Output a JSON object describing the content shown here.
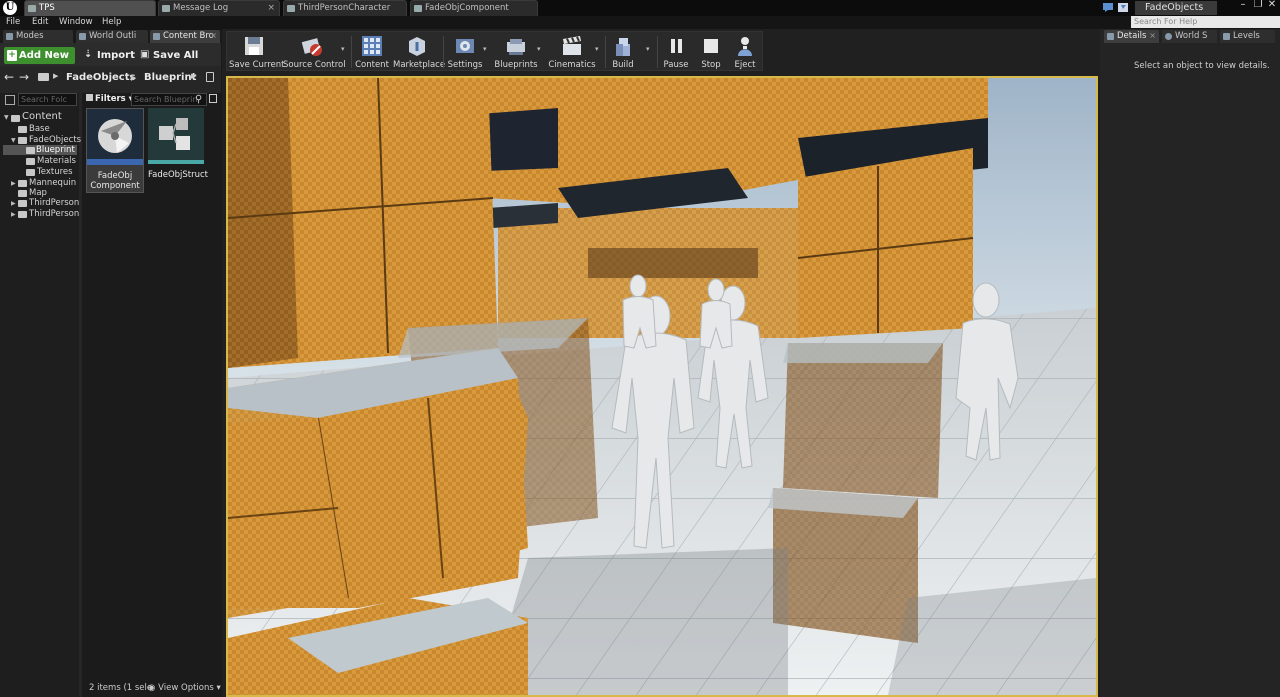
{
  "titlebar": {
    "tabs": [
      {
        "label": "TPS",
        "active": true
      },
      {
        "label": "Message Log",
        "active": false
      },
      {
        "label": "ThirdPersonCharacter",
        "active": false
      },
      {
        "label": "FadeObjComponent",
        "active": false
      }
    ],
    "project_name": "FadeObjects"
  },
  "menu": {
    "items": [
      "File",
      "Edit",
      "Window",
      "Help"
    ],
    "help_search_placeholder": "Search For Help"
  },
  "left_tabs": [
    {
      "label": "Modes"
    },
    {
      "label": "World Outli"
    },
    {
      "label": "Content Bro"
    }
  ],
  "content_browser": {
    "add_new": "Add New",
    "import": "Import",
    "save_all": "Save All",
    "path": [
      "FadeObjects",
      "Blueprint"
    ],
    "sources_search_placeholder": "Search Folc",
    "filters_label": "Filters",
    "asset_search_placeholder": "Search Blueprin",
    "tree": [
      {
        "label": "Content"
      },
      {
        "label": "Base"
      },
      {
        "label": "FadeObjects"
      },
      {
        "label": "Blueprint"
      },
      {
        "label": "Materials"
      },
      {
        "label": "Textures"
      },
      {
        "label": "Mannequin"
      },
      {
        "label": "Map"
      },
      {
        "label": "ThirdPerson"
      },
      {
        "label": "ThirdPerson"
      }
    ],
    "assets": [
      {
        "label": "FadeObj Component"
      },
      {
        "label": "FadeObjStruct"
      }
    ],
    "status": "2 items (1 sele",
    "view_options": "View Options"
  },
  "level_toolbar": [
    {
      "label": "Save Current"
    },
    {
      "label": "Source Control"
    },
    {
      "label": "Content"
    },
    {
      "label": "Marketplace"
    },
    {
      "label": "Settings"
    },
    {
      "label": "Blueprints"
    },
    {
      "label": "Cinematics"
    },
    {
      "label": "Build"
    },
    {
      "label": "Pause"
    },
    {
      "label": "Stop"
    },
    {
      "label": "Eject"
    }
  ],
  "right_panel": {
    "tabs": [
      {
        "label": "Details"
      },
      {
        "label": "World S"
      },
      {
        "label": "Levels"
      }
    ],
    "empty_message": "Select an object to view details."
  },
  "colors": {
    "accent_green": "#3e8f2e",
    "viewport_border": "#d7b84a",
    "crate_orange": "#d89a3c",
    "panel_bg": "#262626"
  }
}
